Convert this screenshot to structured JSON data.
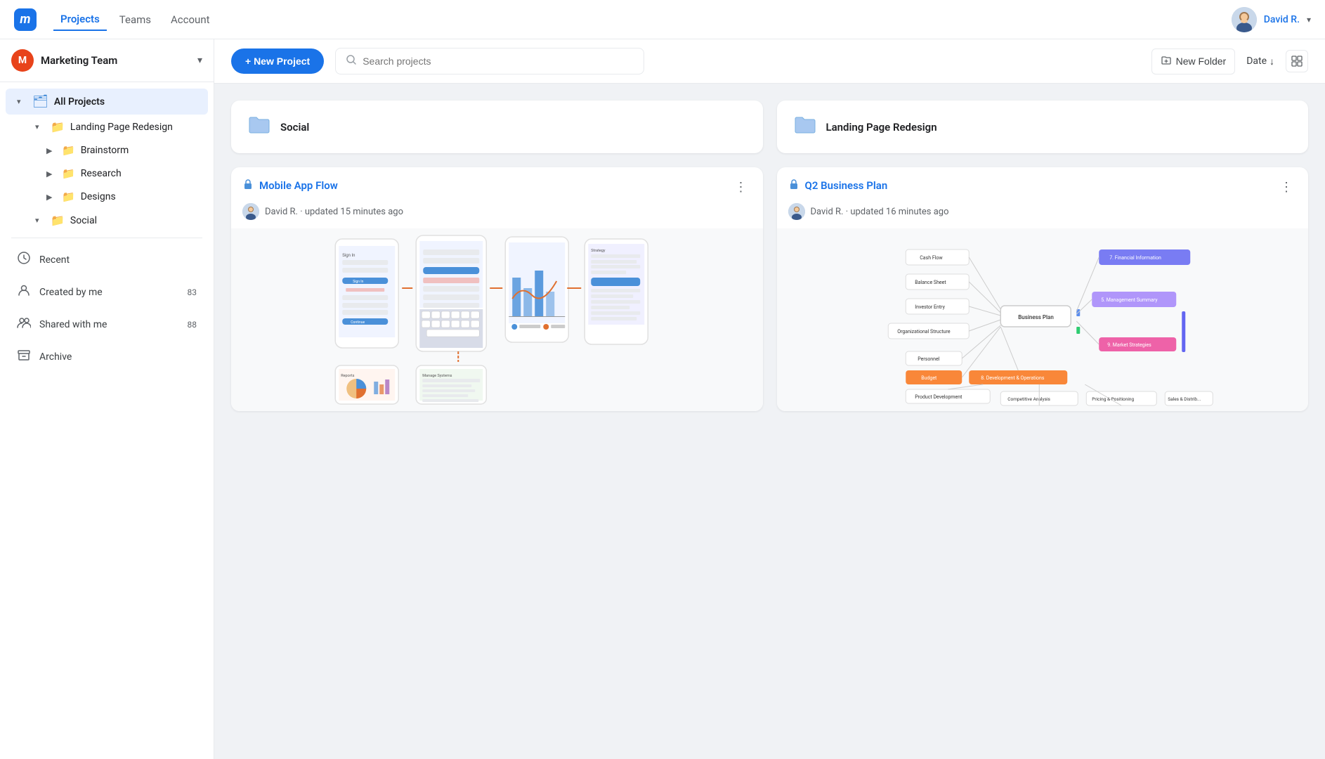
{
  "app": {
    "logo": "m",
    "nav": {
      "links": [
        {
          "label": "Projects",
          "active": true
        },
        {
          "label": "Teams",
          "active": false
        },
        {
          "label": "Account",
          "active": false
        }
      ]
    },
    "user": {
      "name": "David R.",
      "chevron": "▾"
    }
  },
  "sidebar": {
    "workspace": {
      "initial": "M",
      "name": "Marketing Team",
      "chevron": "▾"
    },
    "allProjects": "All Projects",
    "tree": [
      {
        "label": "Landing Page Redesign",
        "children": [
          {
            "label": "Brainstorm",
            "children": []
          },
          {
            "label": "Research",
            "children": []
          },
          {
            "label": "Designs",
            "children": []
          }
        ]
      },
      {
        "label": "Social",
        "children": []
      }
    ],
    "nav": [
      {
        "icon": "clock",
        "label": "Recent"
      },
      {
        "icon": "person",
        "label": "Created by me",
        "badge": "83"
      },
      {
        "icon": "people",
        "label": "Shared with me",
        "badge": "88"
      },
      {
        "icon": "archive",
        "label": "Archive"
      }
    ]
  },
  "toolbar": {
    "newProject": "+ New Project",
    "search": {
      "placeholder": "Search projects"
    },
    "newFolder": "New Folder",
    "dateSort": "Date",
    "sortArrow": "↓"
  },
  "projects": {
    "folders": [
      {
        "name": "Social"
      },
      {
        "name": "Landing Page Redesign"
      }
    ],
    "cards": [
      {
        "title": "Mobile App Flow",
        "type": "locked",
        "author": "David R.",
        "updated": "updated 15 minutes ago",
        "previewType": "mobile"
      },
      {
        "title": "Q2 Business Plan",
        "type": "locked",
        "author": "David R.",
        "updated": "updated 16 minutes ago",
        "previewType": "mindmap"
      }
    ]
  }
}
